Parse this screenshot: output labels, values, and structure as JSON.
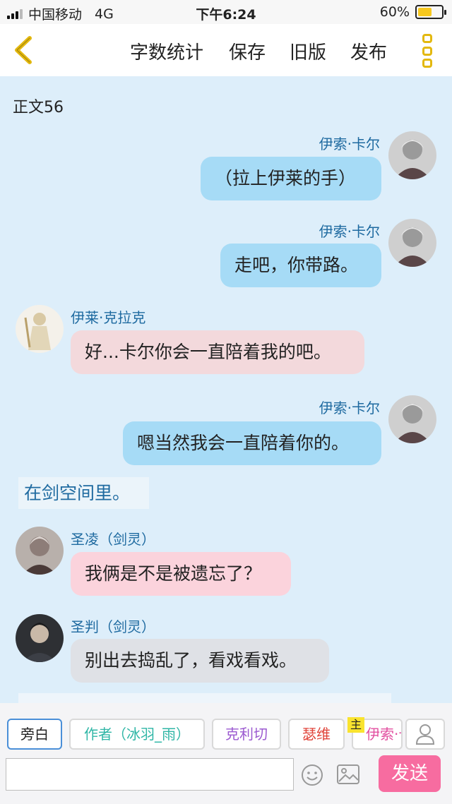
{
  "status_bar": {
    "carrier": "中国移动",
    "network": "4G",
    "time": "下午6:24",
    "battery_percent": "60%",
    "battery_level": 0.6
  },
  "header": {
    "back_icon": "chevron-left-icon",
    "nav": [
      "字数统计",
      "保存",
      "旧版",
      "发布"
    ],
    "menu_icon": "more-vertical-icon",
    "accent_color": "#e3b80f"
  },
  "content": {
    "word_count": "正文56",
    "messages": [
      {
        "side": "right",
        "name": "伊索·卡尔",
        "text": "（拉上伊莱的手）",
        "color": "#a6dbf6"
      },
      {
        "side": "right",
        "name": "伊索·卡尔",
        "text": "走吧，你带路。",
        "color": "#a6dbf6"
      },
      {
        "side": "left",
        "name": "伊莱·克拉克",
        "text": "好...卡尔你会一直陪着我的吧。",
        "color": "#f3d9dc"
      },
      {
        "side": "right",
        "name": "伊索·卡尔",
        "text": "嗯当然我会一直陪着你的。",
        "color": "#a6dbf6"
      },
      {
        "side": "left",
        "name": "圣凌（剑灵）",
        "text": "我俩是不是被遗忘了？",
        "color": "#fbd3dc"
      },
      {
        "side": "left",
        "name": "圣判（剑灵）",
        "text": "别出去捣乱了，看戏看戏。",
        "color": "#dfe1e6"
      }
    ],
    "narration": "在剑空间里。"
  },
  "role_bar": {
    "roles": [
      {
        "label": "旁白",
        "color": "#222222",
        "selected": true
      },
      {
        "label": "作者（冰羽_雨）",
        "color": "#2fb6a6",
        "selected": false
      },
      {
        "label": "克利切",
        "color": "#9b59d0",
        "selected": false
      },
      {
        "label": "瑟维",
        "color": "#e0443a",
        "selected": false
      },
      {
        "label": "伊索·卡尔",
        "color": "#e24fa0",
        "selected": false
      }
    ],
    "main_badge": "主",
    "user_icon": "user-icon"
  },
  "input_bar": {
    "placeholder": "",
    "emoji_icon": "smiley-icon",
    "image_icon": "image-icon",
    "send_label": "发送",
    "send_color": "#f76ca0"
  }
}
